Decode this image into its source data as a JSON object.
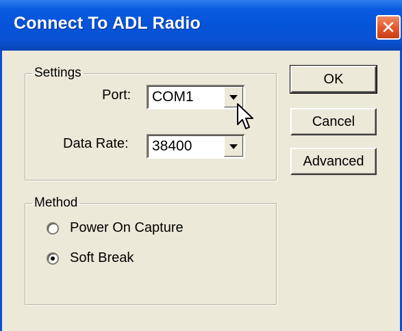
{
  "window": {
    "title": "Connect To ADL Radio",
    "close_glyph": "✕"
  },
  "settings": {
    "legend": "Settings",
    "port": {
      "label": "Port:",
      "value": "COM1"
    },
    "data_rate": {
      "label": "Data Rate:",
      "value": "38400"
    }
  },
  "method": {
    "legend": "Method",
    "options": [
      {
        "label": "Power On Capture",
        "selected": false
      },
      {
        "label": "Soft Break",
        "selected": true
      }
    ]
  },
  "buttons": {
    "ok": "OK",
    "cancel": "Cancel",
    "advanced": "Advanced"
  },
  "colors": {
    "titlebar": "#0553d8",
    "dialog_bg": "#ece9d8",
    "close_button": "#e2562b"
  }
}
